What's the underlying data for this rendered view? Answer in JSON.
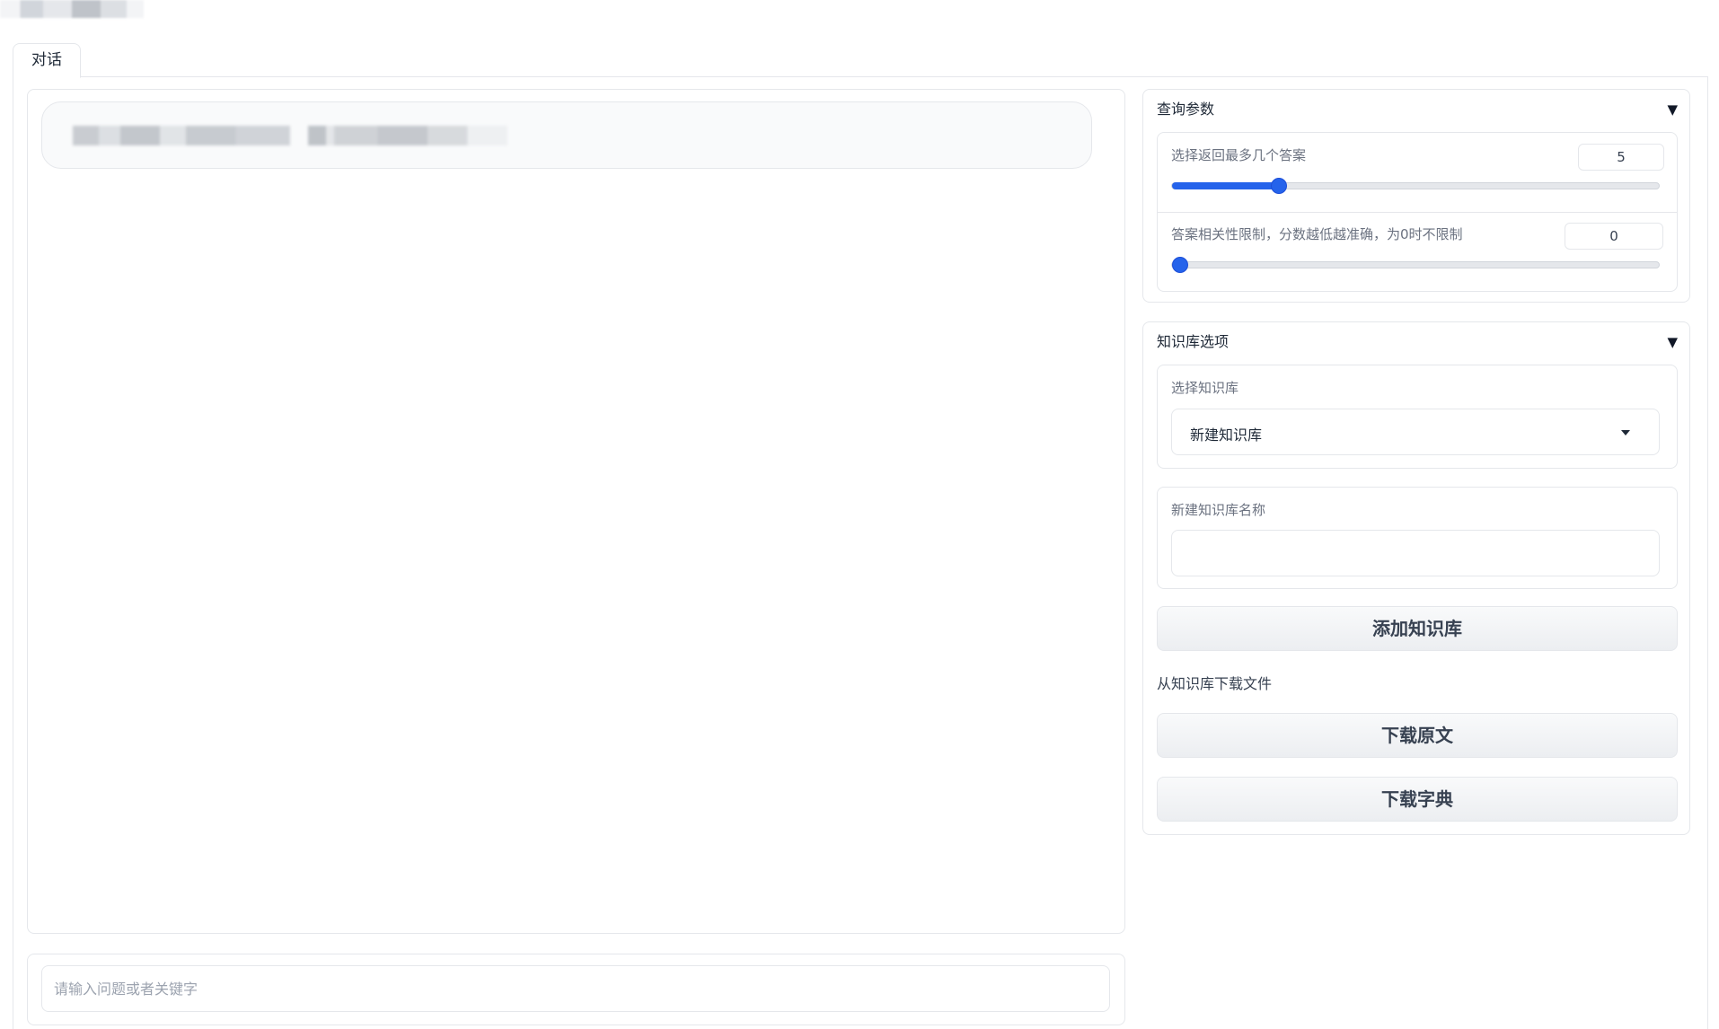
{
  "tabs": [
    {
      "label": "对话"
    }
  ],
  "chat": {
    "input_placeholder": "请输入问题或者关键字"
  },
  "query_params": {
    "title": "查询参数",
    "top_k": {
      "label": "选择返回最多几个答案",
      "value": "5",
      "fraction": 0.22
    },
    "score_threshold": {
      "label": "答案相关性限制，分数越低越准确，为0时不限制",
      "value": "0",
      "fraction": 0.0
    }
  },
  "kb_options": {
    "title": "知识库选项",
    "select_label": "选择知识库",
    "select_value": "新建知识库",
    "new_name_label": "新建知识库名称",
    "new_name_value": "",
    "add_button": "添加知识库",
    "download_section": "从知识库下载文件",
    "download_original_button": "下载原文",
    "download_dict_button": "下载字典"
  },
  "accent_color": "#2563eb"
}
